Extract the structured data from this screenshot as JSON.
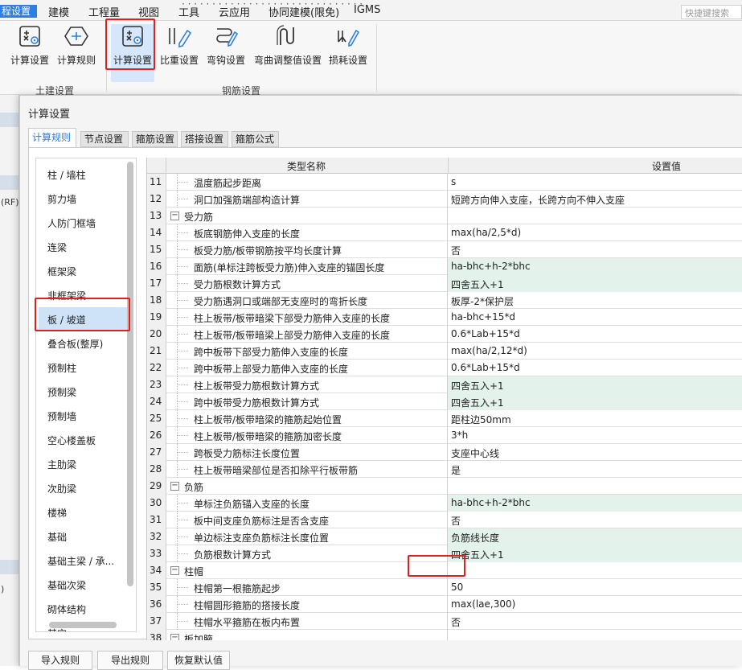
{
  "menubar": {
    "active_tab": "程设置",
    "items": [
      "建模",
      "工程量",
      "视图",
      "工具",
      "云应用",
      "协同建模(限免)",
      "IGMS"
    ],
    "search_placeholder": "快捷键搜索"
  },
  "ribbon": {
    "buttons": [
      {
        "label": "计算设置",
        "icon": "calc-settings-icon"
      },
      {
        "label": "计算规则",
        "icon": "calc-rules-icon"
      },
      {
        "label": "计算设置",
        "icon": "calc-settings-icon"
      },
      {
        "label": "比重设置",
        "icon": "weight-icon"
      },
      {
        "label": "弯钩设置",
        "icon": "hook-icon"
      },
      {
        "label": "弯曲调整值设置",
        "icon": "bend-adjust-icon"
      },
      {
        "label": "损耗设置",
        "icon": "loss-icon"
      }
    ],
    "groups": [
      "土建设置",
      "钢筋设置"
    ]
  },
  "left_strip": {
    "labels": [
      "(RF)",
      ")"
    ]
  },
  "dialog": {
    "title": "计算设置",
    "tabs": [
      "计算规则",
      "节点设置",
      "箍筋设置",
      "搭接设置",
      "箍筋公式"
    ],
    "active_tab": 0,
    "categories": [
      "柱 / 墙柱",
      "剪力墙",
      "人防门框墙",
      "连梁",
      "框架梁",
      "非框架梁",
      "板 / 坡道",
      "叠合板(整厚)",
      "预制柱",
      "预制梁",
      "预制墙",
      "空心楼盖板",
      "主肋梁",
      "次肋梁",
      "楼梯",
      "基础",
      "基础主梁 / 承...",
      "基础次梁",
      "砌体结构",
      "其它"
    ],
    "selected_category": 6,
    "table": {
      "headers": [
        "类型名称",
        "设置值"
      ],
      "rows": [
        {
          "num": "11",
          "name": "温度筋起步距离",
          "value": "s",
          "level": 1,
          "mod": false
        },
        {
          "num": "12",
          "name": "洞口加强筋端部构造计算",
          "value": "短跨方向伸入支座，长跨方向不伸入支座",
          "level": 1,
          "mod": false
        },
        {
          "num": "13",
          "name": "受力筋",
          "value": "",
          "level": 0,
          "mod": false
        },
        {
          "num": "14",
          "name": "板底钢筋伸入支座的长度",
          "value": "max(ha/2,5*d)",
          "level": 1,
          "mod": false
        },
        {
          "num": "15",
          "name": "板受力筋/板带钢筋按平均长度计算",
          "value": "否",
          "level": 1,
          "mod": false
        },
        {
          "num": "16",
          "name": "面筋(单标注跨板受力筋)伸入支座的锚固长度",
          "value": "ha-bhc+h-2*bhc",
          "level": 1,
          "mod": true
        },
        {
          "num": "17",
          "name": "受力筋根数计算方式",
          "value": "四舍五入+1",
          "level": 1,
          "mod": true
        },
        {
          "num": "18",
          "name": "受力筋遇洞口或端部无支座时的弯折长度",
          "value": "板厚-2*保护层",
          "level": 1,
          "mod": false
        },
        {
          "num": "19",
          "name": "柱上板带/板带暗梁下部受力筋伸入支座的长度",
          "value": "ha-bhc+15*d",
          "level": 1,
          "mod": false
        },
        {
          "num": "20",
          "name": "柱上板带/板带暗梁上部受力筋伸入支座的长度",
          "value": "0.6*Lab+15*d",
          "level": 1,
          "mod": false
        },
        {
          "num": "21",
          "name": "跨中板带下部受力筋伸入支座的长度",
          "value": "max(ha/2,12*d)",
          "level": 1,
          "mod": false
        },
        {
          "num": "22",
          "name": "跨中板带上部受力筋伸入支座的长度",
          "value": "0.6*Lab+15*d",
          "level": 1,
          "mod": false
        },
        {
          "num": "23",
          "name": "柱上板带受力筋根数计算方式",
          "value": "四舍五入+1",
          "level": 1,
          "mod": true
        },
        {
          "num": "24",
          "name": "跨中板带受力筋根数计算方式",
          "value": "四舍五入+1",
          "level": 1,
          "mod": true
        },
        {
          "num": "25",
          "name": "柱上板带/板带暗梁的箍筋起始位置",
          "value": "距柱边50mm",
          "level": 1,
          "mod": false
        },
        {
          "num": "26",
          "name": "柱上板带/板带暗梁的箍筋加密长度",
          "value": "3*h",
          "level": 1,
          "mod": false
        },
        {
          "num": "27",
          "name": "跨板受力筋标注长度位置",
          "value": "支座中心线",
          "level": 1,
          "mod": false
        },
        {
          "num": "28",
          "name": "柱上板带暗梁部位是否扣除平行板带筋",
          "value": "是",
          "level": 1,
          "mod": false
        },
        {
          "num": "29",
          "name": "负筋",
          "value": "",
          "level": 0,
          "mod": false
        },
        {
          "num": "30",
          "name": "单标注负筋锚入支座的长度",
          "value": "ha-bhc+h-2*bhc",
          "level": 1,
          "mod": true
        },
        {
          "num": "31",
          "name": "板中间支座负筋标注是否含支座",
          "value": "否",
          "level": 1,
          "mod": false
        },
        {
          "num": "32",
          "name": "单边标注支座负筋标注长度位置",
          "value": "负筋线长度",
          "level": 1,
          "mod": true
        },
        {
          "num": "33",
          "name": "负筋根数计算方式",
          "value": "四舍五入+1",
          "level": 1,
          "mod": true
        },
        {
          "num": "34",
          "name": "柱帽",
          "value": "",
          "level": 0,
          "mod": false
        },
        {
          "num": "35",
          "name": "柱帽第一根箍筋起步",
          "value": "50",
          "level": 1,
          "mod": false
        },
        {
          "num": "36",
          "name": "柱帽圆形箍筋的搭接长度",
          "value": "max(lae,300)",
          "level": 1,
          "mod": false
        },
        {
          "num": "37",
          "name": "柱帽水平箍筋在板内布置",
          "value": "否",
          "level": 1,
          "mod": false
        },
        {
          "num": "38",
          "name": "板加腋",
          "value": "",
          "level": 0,
          "mod": false
        }
      ]
    },
    "buttons": [
      "导入规则",
      "导出规则",
      "恢复默认值"
    ]
  },
  "colors": {
    "accent": "#2d7ee6",
    "highlight": "#e02020",
    "modified_cell": "#e3f3ec",
    "selected_item": "#cfe3f8"
  }
}
